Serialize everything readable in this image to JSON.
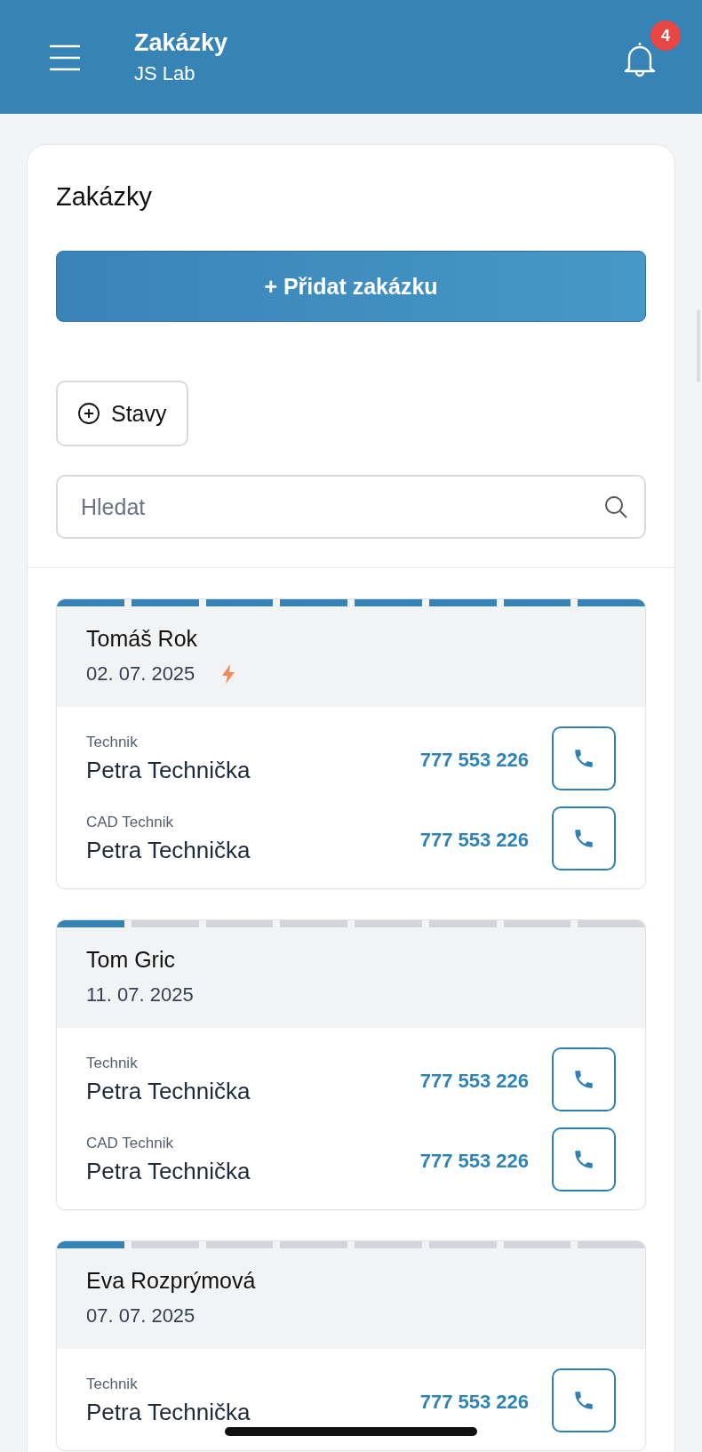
{
  "header": {
    "title": "Zakázky",
    "subtitle": "JS Lab",
    "notifications": "4"
  },
  "panel": {
    "title": "Zakázky",
    "add_button": "+ Přidat zakázku",
    "states_button": "Stavy",
    "search": {
      "placeholder": "Hledat"
    }
  },
  "orders": [
    {
      "customer": "Tomáš Rok",
      "date": "02. 07. 2025",
      "urgent": true,
      "stages": [
        {
          "done": true
        },
        {
          "done": true
        },
        {
          "done": true
        },
        {
          "done": true
        },
        {
          "done": true
        },
        {
          "done": true
        },
        {
          "done": true
        },
        {
          "done": true
        }
      ],
      "contacts": [
        {
          "role": "Technik",
          "name": "Petra Technička",
          "phone": "777 553 226"
        },
        {
          "role": "CAD Technik",
          "name": "Petra Technička",
          "phone": "777 553 226"
        }
      ]
    },
    {
      "customer": "Tom Gric",
      "date": "11. 07. 2025",
      "urgent": false,
      "stages": [
        {
          "done": true
        },
        {
          "done": false
        },
        {
          "done": false
        },
        {
          "done": false
        },
        {
          "done": false
        },
        {
          "done": false
        },
        {
          "done": false
        },
        {
          "done": false
        }
      ],
      "contacts": [
        {
          "role": "Technik",
          "name": "Petra Technička",
          "phone": "777 553 226"
        },
        {
          "role": "CAD Technik",
          "name": "Petra Technička",
          "phone": "777 553 226"
        }
      ]
    },
    {
      "customer": "Eva Rozprýmová",
      "date": "07. 07. 2025",
      "urgent": false,
      "stages": [
        {
          "done": true
        },
        {
          "done": false
        },
        {
          "done": false
        },
        {
          "done": false
        },
        {
          "done": false
        },
        {
          "done": false
        },
        {
          "done": false
        },
        {
          "done": false
        }
      ],
      "contacts": [
        {
          "role": "Technik",
          "name": "Petra Technička",
          "phone": "777 553 226"
        }
      ]
    }
  ]
}
